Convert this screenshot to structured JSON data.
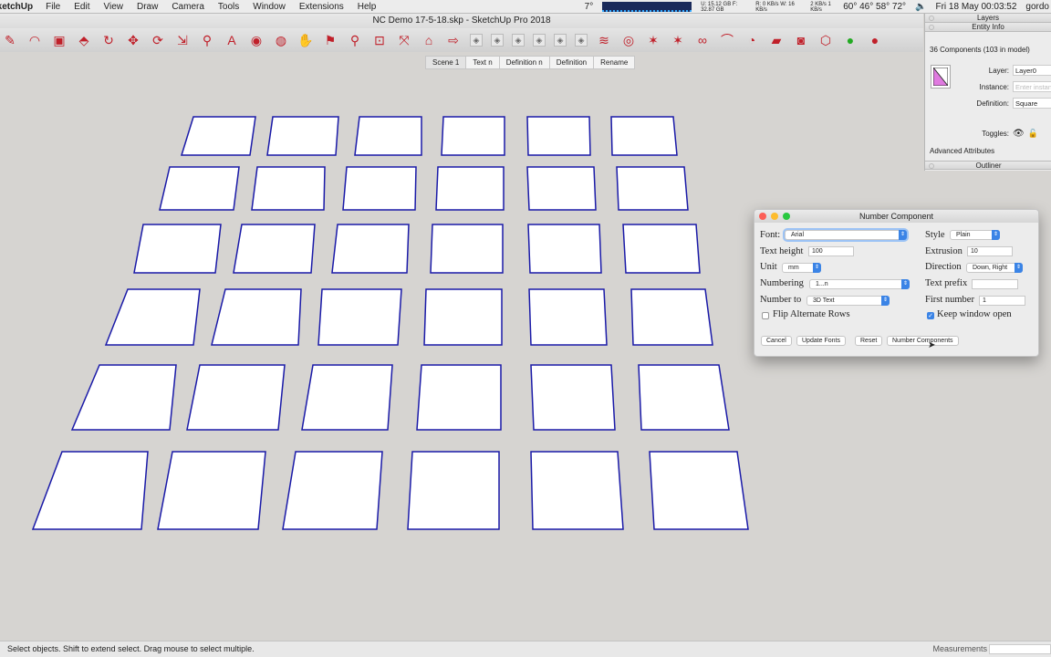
{
  "menubar": {
    "app": "SketchUp",
    "items": [
      "File",
      "Edit",
      "View",
      "Draw",
      "Camera",
      "Tools",
      "Window",
      "Extensions",
      "Help"
    ],
    "status": {
      "temp": "7°",
      "disk": "U: 15.12 GB F: 32.87 GB",
      "rw": "R: 0 KB/s W: 16 KB/s",
      "net": "2 KB/s 1 KB/s",
      "cpu_temps": "60° 46° 58° 72°",
      "datetime": "Fri 18 May 00:03:52",
      "user": "gordo"
    }
  },
  "window": {
    "title": "NC Demo 17-5-18.skp - SketchUp Pro 2018"
  },
  "toolbar": {
    "icons": [
      "pencil-icon",
      "arc-icon",
      "rectangle-icon",
      "push-pull-icon",
      "follow-me-icon",
      "move-icon",
      "rotate-icon",
      "scale-icon",
      "tape-measure-icon",
      "text-icon",
      "paint-bucket-icon",
      "orbit-icon",
      "pan-icon",
      "walk-icon",
      "zoom-icon",
      "zoom-window-icon",
      "zoom-extents-icon",
      "warehouse-icon",
      "send-to-layout-icon",
      "style-xray-icon",
      "style-wireframe-icon",
      "style-hidden-icon",
      "style-shaded-icon",
      "style-textured-icon",
      "style-monochrome-icon",
      "spring-icon",
      "sphere-icon",
      "explode-icon",
      "explode-s-icon",
      "link-icon",
      "curve-icon",
      "solid-icon",
      "folder-icon",
      "camera-icon",
      "box-icon",
      "add-icon",
      "remove-icon"
    ]
  },
  "scenes": [
    "Scene 1",
    "Text n",
    "Definition n",
    "Definition",
    "Rename"
  ],
  "trays": {
    "layers": "Layers",
    "entity_info": "Entity Info",
    "summary": "36 Components (103 in model)",
    "layer_label": "Layer:",
    "layer_value": "Layer0",
    "instance_label": "Instance:",
    "instance_placeholder": "Enter instance name",
    "definition_label": "Definition:",
    "definition_value": "Square",
    "toggles_label": "Toggles:",
    "advanced": "Advanced Attributes",
    "outliner": "Outliner"
  },
  "dialog": {
    "title": "Number Component",
    "font_label": "Font:",
    "font_value": "Arial",
    "style_label": "Style",
    "style_value": "Plain",
    "text_height_label": "Text height",
    "text_height_value": "100",
    "extrusion_label": "Extrusion",
    "extrusion_value": "10",
    "unit_label": "Unit",
    "unit_value": "mm",
    "direction_label": "Direction",
    "direction_value": "Down, Right",
    "numbering_label": "Numbering",
    "numbering_value": "1...n",
    "prefix_label": "Text prefix",
    "prefix_value": "",
    "number_to_label": "Number to",
    "number_to_value": "3D Text",
    "first_number_label": "First number",
    "first_number_value": "1",
    "flip_label": "Flip Alternate Rows",
    "flip_checked": false,
    "keep_open_label": "Keep window open",
    "keep_open_checked": true,
    "buttons": {
      "cancel": "Cancel",
      "update_fonts": "Update Fonts",
      "reset": "Reset",
      "number": "Number Components"
    }
  },
  "statusbar": {
    "hint": "Select objects. Shift to extend select. Drag mouse to select multiple.",
    "measurements_label": "Measurements",
    "measurements_value": ""
  },
  "colors": {
    "component_edge": "#1a1aa8",
    "background": "#d6d4d1",
    "accent": "#3b84e6"
  }
}
